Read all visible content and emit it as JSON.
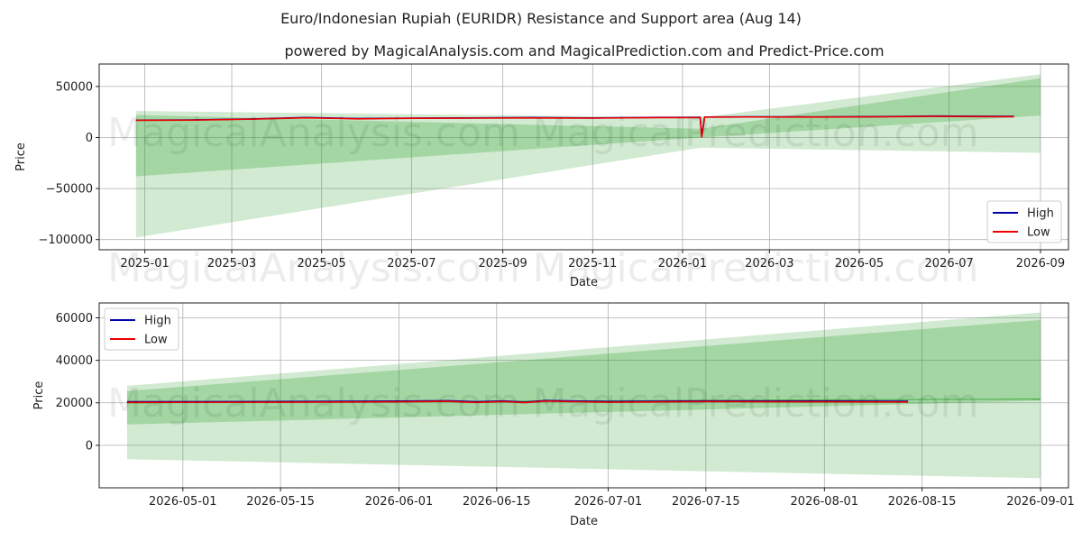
{
  "figure": {
    "title": "Euro/Indonesian Rupiah (EURIDR) Resistance and Support area (Aug 14)",
    "subtitle": "powered by MagicalAnalysis.com and MagicalPrediction.com and Predict-Price.com",
    "watermarks": [
      "MagicalAnalysis.com",
      "MagicalPrediction.com"
    ]
  },
  "colors": {
    "high": "#0000aa",
    "low": "#ee0000",
    "band": "#2ca02c",
    "grid": "#b0b0b0",
    "axis": "#222222"
  },
  "chart_data": [
    {
      "type": "line",
      "panel": "top",
      "xlabel": "Date",
      "ylabel": "Price",
      "xlim": [
        "2024-12-01",
        "2026-09-20"
      ],
      "ylim": [
        -110000,
        72000
      ],
      "xticks": [
        "2025-01",
        "2025-03",
        "2025-05",
        "2025-07",
        "2025-09",
        "2025-11",
        "2026-01",
        "2026-03",
        "2026-05",
        "2026-07",
        "2026-09"
      ],
      "tick_dates": [
        "2025-01-01",
        "2025-03-01",
        "2025-05-01",
        "2025-07-01",
        "2025-09-01",
        "2025-11-01",
        "2026-01-01",
        "2026-03-01",
        "2026-05-01",
        "2026-07-01",
        "2026-09-01"
      ],
      "yticks": [
        -100000,
        -50000,
        0,
        50000
      ],
      "ytick_labels": [
        "−100000",
        "−50000",
        "0",
        "50000"
      ],
      "grid": true,
      "legend": {
        "position": "lower right",
        "entries": [
          "High",
          "Low"
        ]
      },
      "series": [
        {
          "name": "High",
          "x": [
            "2024-12-26",
            "2025-02-01",
            "2025-03-15",
            "2025-04-20",
            "2025-05-25",
            "2025-07-01",
            "2025-08-10",
            "2025-09-20",
            "2025-11-01",
            "2025-12-15",
            "2026-01-13",
            "2026-01-14",
            "2026-01-16",
            "2026-02-15",
            "2026-04-01",
            "2026-05-15",
            "2026-06-20",
            "2026-07-20",
            "2026-08-14"
          ],
          "y": [
            17000,
            17200,
            18200,
            19600,
            18600,
            19000,
            19200,
            19500,
            19200,
            19700,
            19800,
            1000,
            20100,
            20300,
            20200,
            20500,
            21000,
            20800,
            20700
          ]
        },
        {
          "name": "Low",
          "x": [
            "2024-12-26",
            "2025-02-01",
            "2025-03-15",
            "2025-04-20",
            "2025-05-25",
            "2025-07-01",
            "2025-08-10",
            "2025-09-20",
            "2025-11-01",
            "2025-12-15",
            "2026-01-13",
            "2026-01-14",
            "2026-01-16",
            "2026-02-15",
            "2026-04-01",
            "2026-05-15",
            "2026-06-20",
            "2026-07-20",
            "2026-08-14"
          ],
          "y": [
            16800,
            17000,
            18000,
            19300,
            18300,
            18800,
            19000,
            19200,
            19000,
            19500,
            19500,
            0,
            19900,
            20100,
            20000,
            20300,
            20700,
            20500,
            20400
          ]
        }
      ],
      "bands": [
        {
          "x": [
            "2024-12-26",
            "2026-01-13",
            "2026-09-01"
          ],
          "upper": [
            22000,
            8500,
            58000
          ],
          "lower": [
            -38000,
            0,
            21500
          ]
        },
        {
          "x": [
            "2024-12-26",
            "2026-01-13",
            "2026-09-01"
          ],
          "upper": [
            26000,
            19500,
            62000
          ],
          "lower": [
            -98000,
            -10000,
            -15000
          ]
        }
      ]
    },
    {
      "type": "line",
      "panel": "bottom",
      "xlabel": "Date",
      "ylabel": "Price",
      "xlim": [
        "2026-04-19",
        "2026-09-05"
      ],
      "ylim": [
        -20000,
        67000
      ],
      "xticks": [
        "2026-05-01",
        "2026-05-15",
        "2026-06-01",
        "2026-06-15",
        "2026-07-01",
        "2026-07-15",
        "2026-08-01",
        "2026-08-15",
        "2026-09-01"
      ],
      "yticks": [
        0,
        20000,
        40000,
        60000
      ],
      "ytick_labels": [
        "0",
        "20000",
        "40000",
        "60000"
      ],
      "grid": true,
      "legend": {
        "position": "upper left",
        "entries": [
          "High",
          "Low"
        ]
      },
      "series": [
        {
          "name": "High",
          "x": [
            "2026-04-23",
            "2026-05-15",
            "2026-06-01",
            "2026-06-08",
            "2026-06-12",
            "2026-06-16",
            "2026-06-19",
            "2026-06-22",
            "2026-07-01",
            "2026-07-15",
            "2026-08-01",
            "2026-08-13"
          ],
          "y": [
            20500,
            20600,
            20800,
            21000,
            20500,
            20900,
            20300,
            21100,
            20600,
            20900,
            20800,
            20700
          ]
        },
        {
          "name": "Low",
          "x": [
            "2026-04-23",
            "2026-05-15",
            "2026-06-01",
            "2026-06-08",
            "2026-06-12",
            "2026-06-16",
            "2026-06-19",
            "2026-06-22",
            "2026-07-01",
            "2026-07-15",
            "2026-08-01",
            "2026-08-13"
          ],
          "y": [
            20200,
            20300,
            20500,
            20700,
            20200,
            20600,
            20100,
            20800,
            20300,
            20600,
            20500,
            20400
          ]
        }
      ],
      "bands": [
        {
          "x": [
            "2026-04-23",
            "2026-09-01"
          ],
          "upper": [
            25500,
            59000
          ],
          "lower": [
            9800,
            21000
          ]
        },
        {
          "x": [
            "2026-04-23",
            "2026-09-01"
          ],
          "upper": [
            28000,
            62500
          ],
          "lower": [
            -6500,
            -15500
          ]
        }
      ],
      "center_line": {
        "x": [
          "2026-04-23",
          "2026-09-01"
        ],
        "y": [
          20000,
          21800
        ]
      }
    }
  ]
}
